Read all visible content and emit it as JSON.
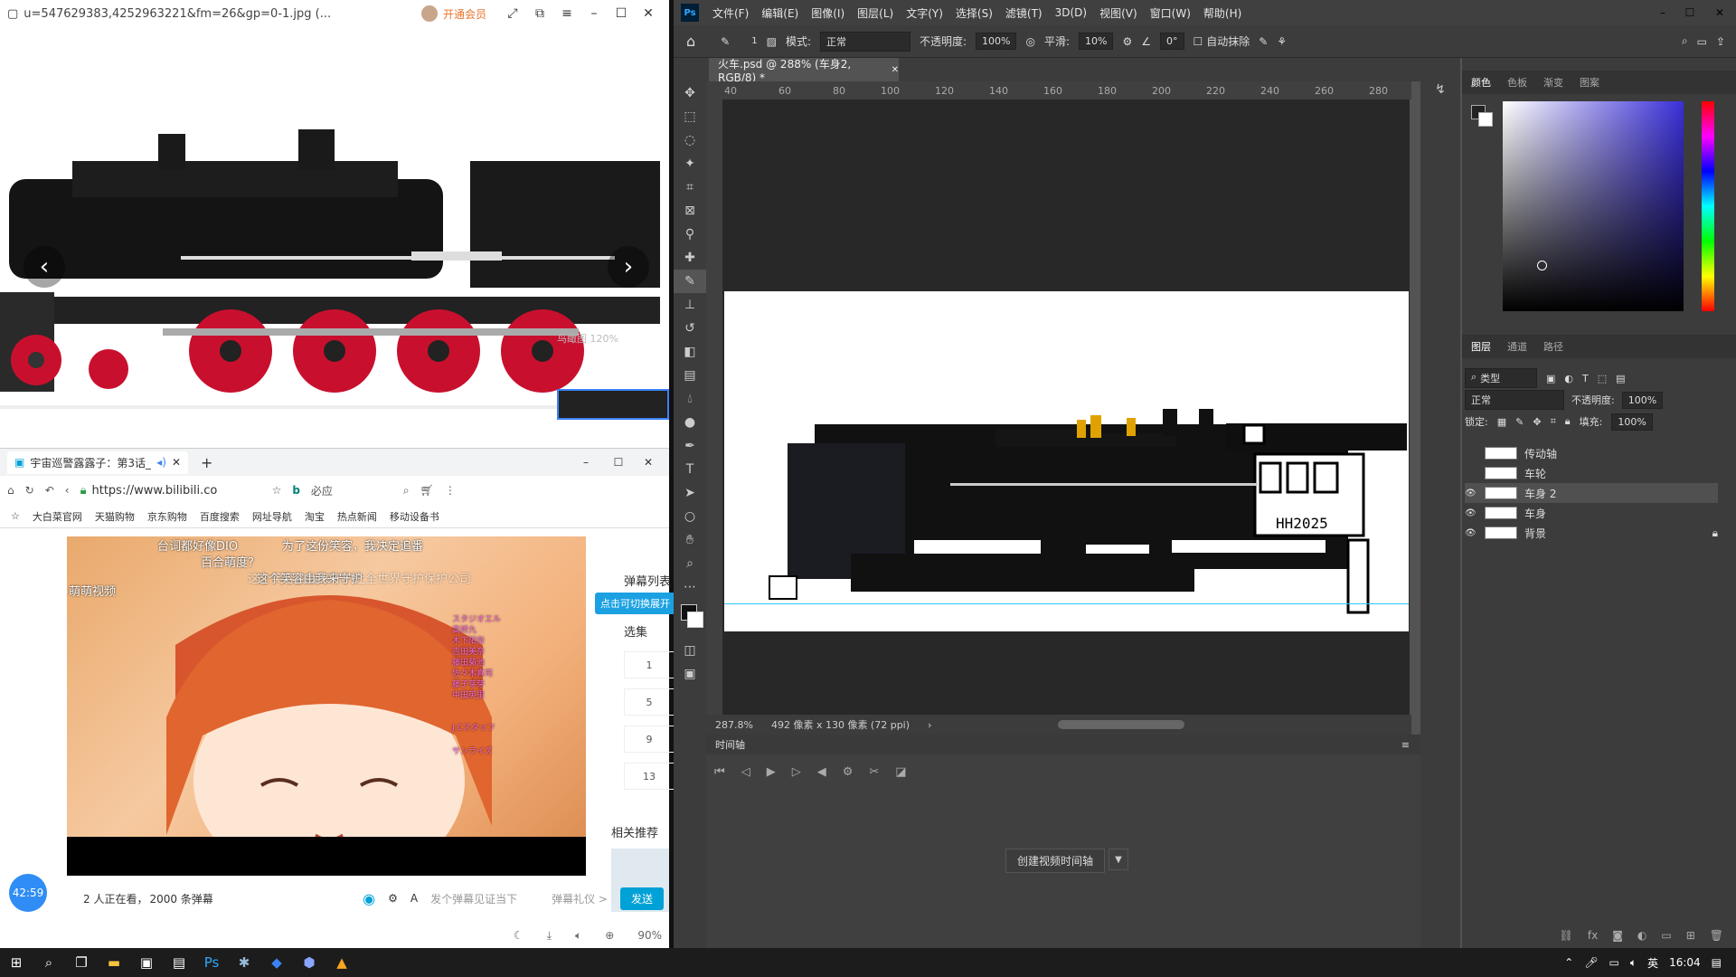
{
  "viewer": {
    "title": "u=547629383,4252963221&fm=26&gp=0-1.jpg (...",
    "vip": "开通会员",
    "zoom_tip": "鸟瞰图 120%"
  },
  "browser": {
    "tab_title": "宇宙巡警露露子：第3话_...",
    "url": "https://www.bilibili.co",
    "search_hint": "必应",
    "bookmarks": [
      "大白菜官网",
      "天猫购物",
      "京东购物",
      "百度搜索",
      "网址导航",
      "淘宝",
      "热点新闻",
      "移动设备书"
    ],
    "danmaku": [
      "台词都好像DIO",
      "为了这份笑容，我决定追番",
      "百合萌度?",
      "这个笑容由我来守护",
      "萌萌视频",
      "这个笑容由我来守护让全世界守护保护公司"
    ],
    "danmaku_small": [
      "スタジオエル",
      "高桥九",
      "木下阳奈",
      "吉田美奈",
      "藤田菊池",
      "佐々木真司",
      "藤子芽芽",
      "中田英里",
      "J.Cスタッフ",
      "サンライズ"
    ],
    "danmu_list": "弹幕列表",
    "danmu_toggle": "点击可切换展开",
    "xuanji": "选集",
    "episodes": [
      "1",
      "5",
      "9",
      "13"
    ],
    "related": "相关推荐",
    "viewers": "2 人正在看，",
    "danmu_count": "2000 条弹幕",
    "input_placeholder": "发个弹幕见证当下",
    "etiquette": "弹幕礼仪 >",
    "send": "发送",
    "timer": "42:59",
    "zoom": "90%"
  },
  "ps": {
    "menu": [
      "文件(F)",
      "编辑(E)",
      "图像(I)",
      "图层(L)",
      "文字(Y)",
      "选择(S)",
      "滤镜(T)",
      "3D(D)",
      "视图(V)",
      "窗口(W)",
      "帮助(H)"
    ],
    "options": {
      "brush_size": "1",
      "mode_label": "模式:",
      "mode": "正常",
      "opacity_label": "不透明度:",
      "opacity": "100%",
      "flow_label": "平滑:",
      "flow": "10%",
      "angle": "0°",
      "auto_erase": "自动抹除"
    },
    "doc_tab": "火车.psd @ 288% (车身2, RGB/8) *",
    "ruler": [
      "40",
      "60",
      "80",
      "100",
      "120",
      "140",
      "160",
      "180",
      "200",
      "220",
      "240",
      "260",
      "280"
    ],
    "status_zoom": "287.8%",
    "status_info": "492 像素 x 130 像素 (72 ppi)",
    "timeline_title": "时间轴",
    "create_timeline": "创建视频时间轴",
    "color_tabs": [
      "颜色",
      "色板",
      "渐变",
      "图案"
    ],
    "layer_tabs": [
      "图层",
      "通道",
      "路径"
    ],
    "layer_filter": "类型",
    "blend_mode": "正常",
    "layer_opacity_label": "不透明度:",
    "layer_opacity": "100%",
    "lock_label": "锁定:",
    "fill_label": "填充:",
    "fill": "100%",
    "layers": [
      "传动轴",
      "车轮",
      "车身 2",
      "车身",
      "背景"
    ],
    "train_text": "HH2025"
  },
  "taskbar": {
    "ime": "英",
    "time": "16:04"
  }
}
